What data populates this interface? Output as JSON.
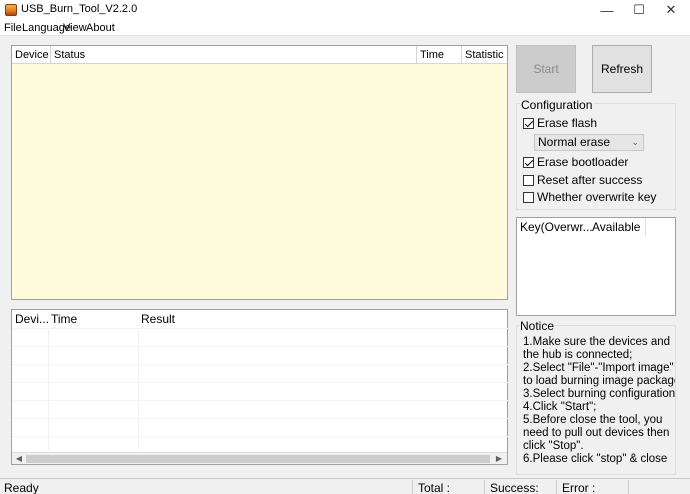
{
  "window": {
    "title": "USB_Burn_Tool_V2.2.0",
    "min_glyph": "—",
    "max_glyph": "☐",
    "close_glyph": "✕",
    "icon": "app-logo-icon"
  },
  "menu": [
    "File",
    "Language",
    "View",
    "About"
  ],
  "device_table": {
    "columns": [
      "Device ID",
      "Status",
      "Time",
      "Statistic"
    ],
    "background": "#fffbdc"
  },
  "result_table": {
    "columns": [
      "Devi...",
      "Time",
      "Result"
    ],
    "scroll_left": "◀",
    "scroll_right": "▶"
  },
  "buttons": {
    "start": "Start",
    "refresh": "Refresh"
  },
  "configuration": {
    "title": "Configuration",
    "erase_flash": {
      "label": "Erase flash",
      "checked": true
    },
    "erase_mode": "Normal erase",
    "erase_bootloader": {
      "label": "Erase bootloader",
      "checked": true
    },
    "reset_after_success": {
      "label": "Reset after success",
      "checked": false
    },
    "overwrite_key": {
      "label": "Whether overwrite key",
      "checked": false
    }
  },
  "key_table": {
    "columns": [
      "Key(Overwr...",
      "Available"
    ]
  },
  "notice": {
    "title": "Notice",
    "lines": [
      "1.Make sure the devices and",
      "the hub is connected;",
      "2.Select \"File\"-\"Import image\"",
      "to load burning image package;",
      "3.Select burning configuration;",
      "4.Click \"Start\";",
      "5.Before close the tool, you",
      "need to pull out devices then",
      "click \"Stop\".",
      "6.Please click \"stop\" & close"
    ]
  },
  "status": {
    "state": "Ready",
    "total": "Total :",
    "success": "Success:",
    "error": "Error :"
  }
}
